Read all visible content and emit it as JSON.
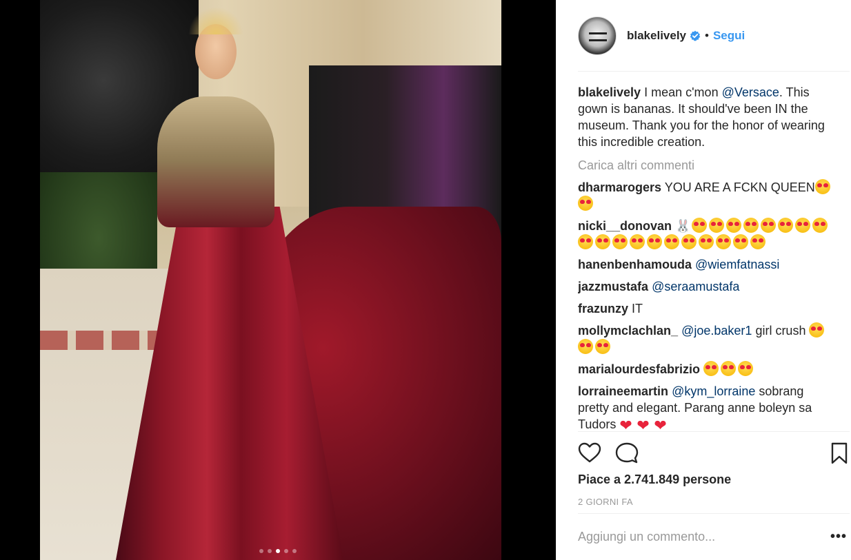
{
  "post": {
    "author": "blakelively",
    "separator": "•",
    "follow_label": "Segui",
    "caption": {
      "user": "blakelively",
      "text_before": "I mean c'mon ",
      "mention": "@Versace",
      "text_after": ". This gown is bananas. It should've been IN the museum. Thank you for the honor of wearing this incredible creation."
    },
    "load_more_label": "Carica altri commenti",
    "comments": [
      {
        "user": "dharmarogers",
        "text": "YOU ARE A FCKN QUEEN",
        "mention": "",
        "trailing": "",
        "emoji": "heart-eyes-emoji",
        "emoji_count": 2
      },
      {
        "user": "nicki__donovan",
        "text": "",
        "mention": "",
        "trailing": "",
        "emoji": "heart-eyes-emoji",
        "emoji_count": 19
      },
      {
        "user": "hanenbenhamouda",
        "text": "",
        "mention": "@wiemfatnassi",
        "trailing": "",
        "emoji": "",
        "emoji_count": 0
      },
      {
        "user": "jazzmustafa",
        "text": "",
        "mention": "@seraamustafa",
        "trailing": "",
        "emoji": "",
        "emoji_count": 0
      },
      {
        "user": "frazunzy",
        "text": "IT",
        "mention": "",
        "trailing": "",
        "emoji": "",
        "emoji_count": 0
      },
      {
        "user": "mollymclachlan_",
        "text": "",
        "mention": "@joe.baker1",
        "trailing": " girl crush ",
        "emoji": "heart-eyes-emoji",
        "emoji_count": 3
      },
      {
        "user": "marialourdesfabrizio",
        "text": "",
        "mention": "",
        "trailing": "",
        "emoji": "heart-eyes-emoji",
        "emoji_count": 3
      },
      {
        "user": "lorraineemartin",
        "text": "",
        "mention": "@kym_lorraine",
        "trailing": " sobrang pretty and elegant. Parang anne boleyn sa Tudors ",
        "emoji": "red-heart-emoji",
        "emoji_count": 3
      }
    ],
    "likes_label": "Piace a 2.741.849 persone",
    "time_label": "2 GIORNI FA",
    "comment_placeholder": "Aggiungi un commento...",
    "more_label": "•••",
    "carousel": {
      "total": 5,
      "active": 2
    },
    "colors": {
      "link": "#3897f0",
      "mention": "#003569",
      "muted": "#999999",
      "verified": "#3897f0"
    }
  }
}
